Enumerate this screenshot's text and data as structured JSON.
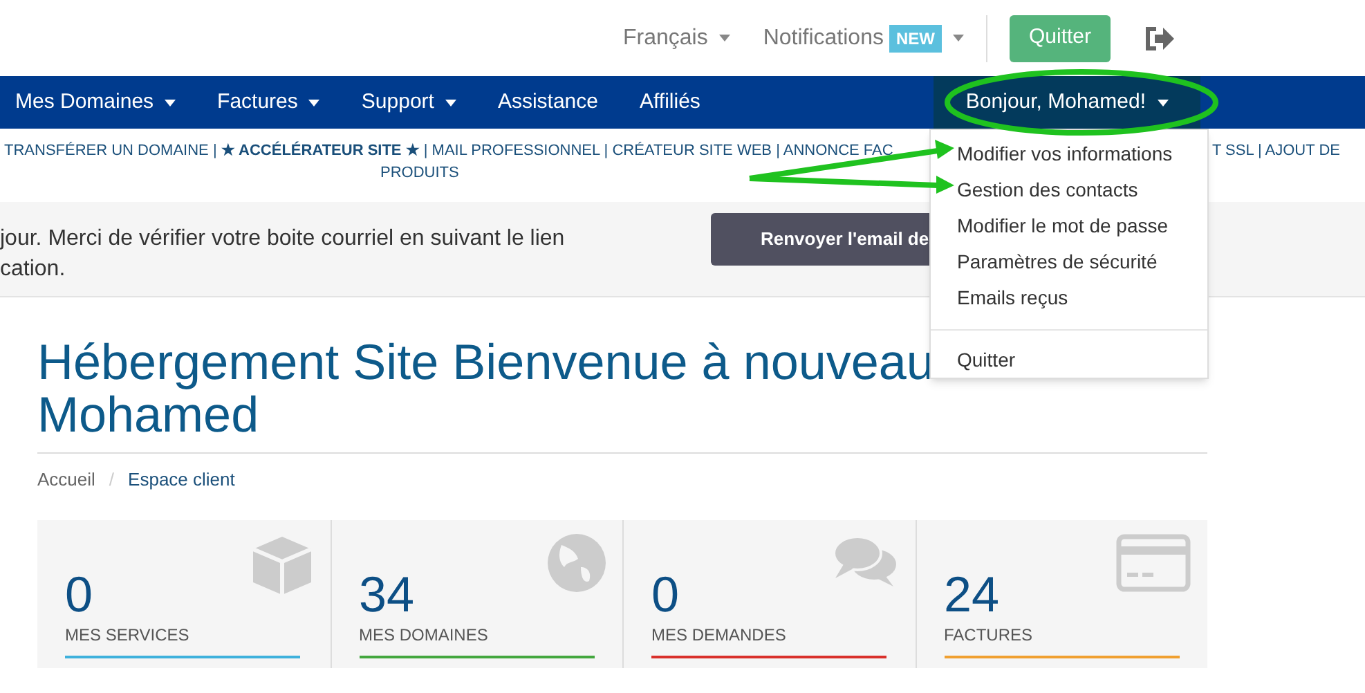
{
  "top_bar": {
    "language": "Français",
    "notifications": {
      "label": "Notifications",
      "badge": "NEW"
    },
    "logout_button": "Quitter"
  },
  "nav": {
    "items": [
      {
        "label": "Mes Domaines",
        "has_menu": true,
        "selected": false
      },
      {
        "label": "Factures",
        "has_menu": true,
        "selected": false
      },
      {
        "label": "Support",
        "has_menu": true,
        "selected": false
      },
      {
        "label": "Assistance",
        "has_menu": false,
        "selected": false
      },
      {
        "label": "Affiliés",
        "has_menu": false,
        "selected": false
      },
      {
        "label": "Bonjour, Mohamed!",
        "has_menu": true,
        "selected": true
      }
    ]
  },
  "shortcuts": {
    "left": "TRANSFÉRER UN DOMAINE | **★ ACCÉLÉRATEUR SITE ★** | MAIL PROFESSIONNEL | CRÉATEUR SITE WEB | ANNONCE FAC",
    "right": "T SSL | AJOUT DE",
    "second_line": "PRODUITS"
  },
  "alert": {
    "lines": [
      "jour. Merci de vérifier votre boite courriel en suivant le lien",
      "cation."
    ],
    "button": "Renvoyer l'email de"
  },
  "user_menu": {
    "items": [
      "Modifier vos informations",
      "Gestion des contacts",
      "Modifier le mot de passe",
      "Paramètres de sécurité",
      "Emails reçus"
    ],
    "footer_item": "Quitter"
  },
  "page": {
    "breadcrumb_separator": "/",
    "title_lines": [
      "Hébergement Site Bienvenue à nouveau",
      "Mohamed"
    ],
    "breadcrumb": [
      {
        "label": "Accueil",
        "selected": false
      },
      {
        "label": "Espace client",
        "selected": true
      }
    ]
  },
  "stats": [
    {
      "kind": "services",
      "value": "0",
      "label": "MES SERVICES",
      "color": "#3fb1dc"
    },
    {
      "kind": "domains",
      "value": "34",
      "label": "MES DOMAINES",
      "color": "#43a73e"
    },
    {
      "kind": "tickets",
      "value": "0",
      "label": "MES DEMANDES",
      "color": "#d9302b"
    },
    {
      "kind": "invoices",
      "value": "24",
      "label": "FACTURES",
      "color": "#f0a030"
    }
  ]
}
